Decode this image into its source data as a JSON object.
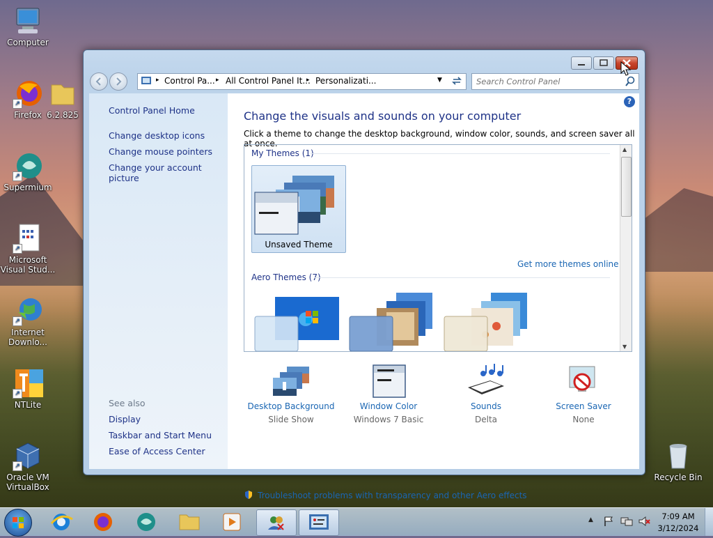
{
  "desktop": {
    "icons": [
      {
        "label": "Computer"
      },
      {
        "label": "Firefox"
      },
      {
        "label": "6.2.825"
      },
      {
        "label": "Supermium"
      },
      {
        "label": "Microsoft Visual Stud..."
      },
      {
        "label": "Internet Downlo..."
      },
      {
        "label": "NTLite"
      },
      {
        "label": "Oracle VM VirtualBox"
      },
      {
        "label": "Recycle Bin"
      }
    ]
  },
  "window": {
    "breadcrumb": [
      "Control Pa...",
      "All Control Panel It...",
      "Personalizati..."
    ],
    "search_placeholder": "Search Control Panel",
    "sidebar": {
      "home": "Control Panel Home",
      "links": [
        "Change desktop icons",
        "Change mouse pointers",
        "Change your account picture"
      ],
      "see_also_title": "See also",
      "see_also": [
        "Display",
        "Taskbar and Start Menu",
        "Ease of Access Center"
      ]
    },
    "main": {
      "title": "Change the visuals and sounds on your computer",
      "subtitle": "Click a theme to change the desktop background, window color, sounds, and screen saver all at once.",
      "my_themes_label": "My Themes (1)",
      "unsaved_theme": "Unsaved Theme",
      "get_more": "Get more themes online",
      "aero_themes_label": "Aero Themes (7)",
      "bottom": [
        {
          "label": "Desktop Background",
          "value": "Slide Show"
        },
        {
          "label": "Window Color",
          "value": "Windows 7 Basic"
        },
        {
          "label": "Sounds",
          "value": "Delta"
        },
        {
          "label": "Screen Saver",
          "value": "None"
        }
      ],
      "troubleshoot": "Troubleshoot problems with transparency and other Aero effects"
    }
  },
  "taskbar": {
    "time": "7:09 AM",
    "date": "3/12/2024"
  },
  "colors": {
    "link": "#1e3287",
    "title": "#1e3287",
    "accent": "#1a66b3"
  }
}
